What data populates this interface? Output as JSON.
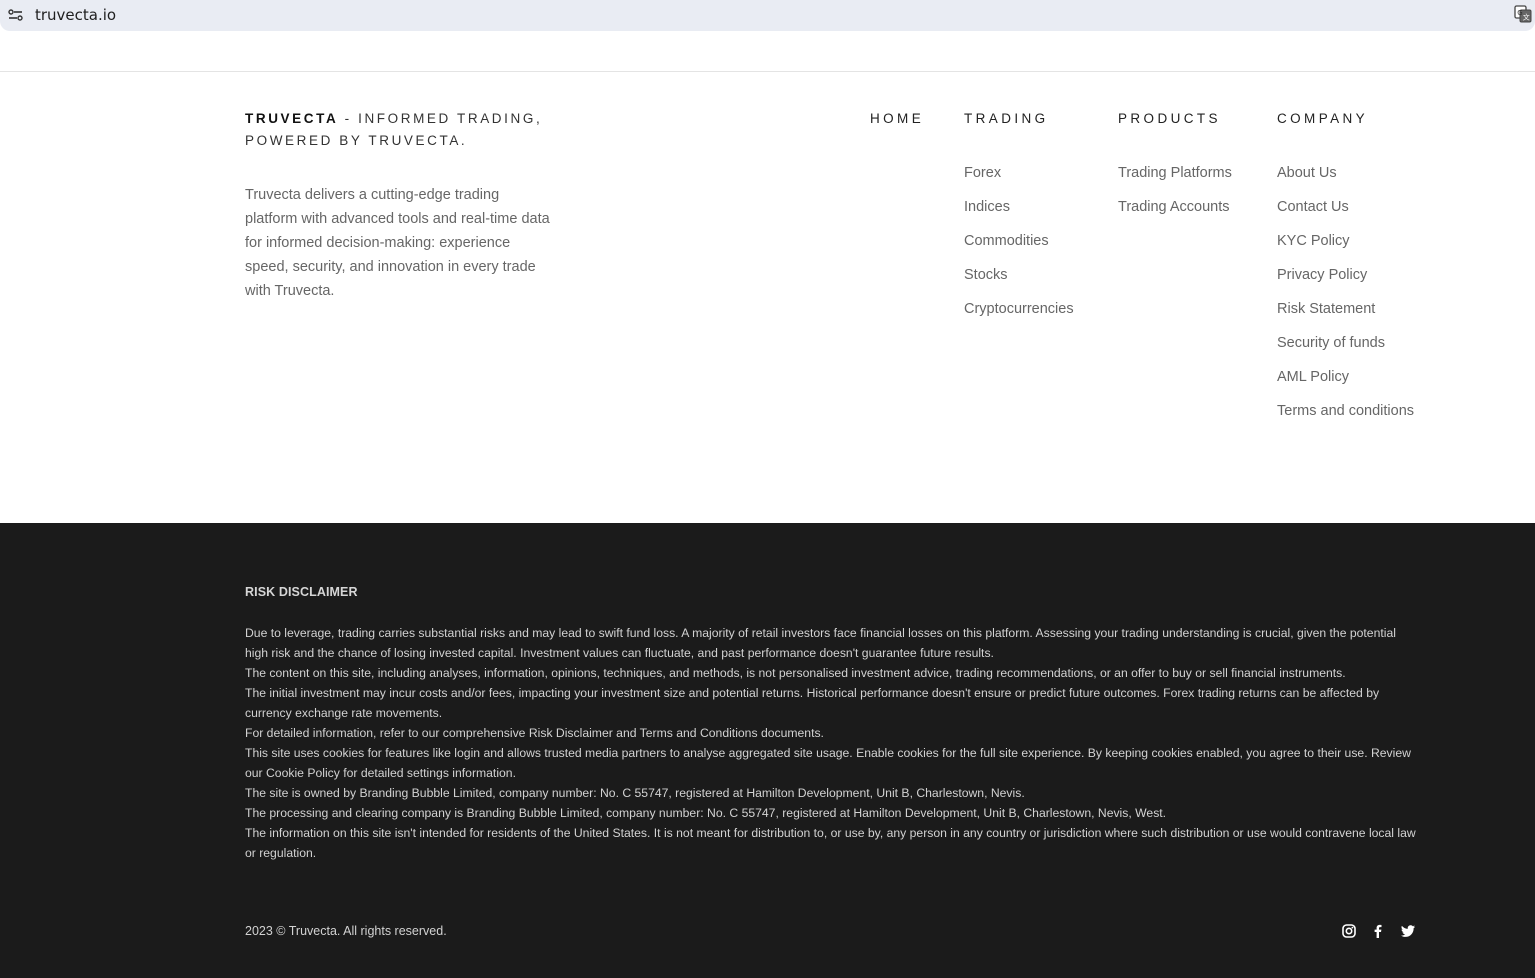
{
  "browser": {
    "url": "truvecta.io",
    "site_info_icon": "tune-icon",
    "translate_icon": "translate-icon"
  },
  "footer": {
    "brand": "TRUVECTA",
    "tagline": " - INFORMED TRADING, POWERED BY TRUVECTA.",
    "description": "Truvecta delivers a cutting-edge trading platform with advanced tools and real-time data for informed decision-making: experience speed, security, and innovation in every trade with Truvecta.",
    "nav": {
      "home": {
        "heading": "HOME"
      },
      "trading": {
        "heading": "TRADING",
        "links": [
          "Forex",
          "Indices",
          "Commodities",
          "Stocks",
          "Cryptocurrencies"
        ]
      },
      "products": {
        "heading": "PRODUCTS",
        "links": [
          "Trading Platforms",
          "Trading Accounts"
        ]
      },
      "company": {
        "heading": "COMPANY",
        "links": [
          "About Us",
          "Contact Us",
          "KYC Policy",
          "Privacy Policy",
          "Risk Statement",
          "Security of funds",
          "AML Policy",
          "Terms and conditions"
        ]
      }
    }
  },
  "disclaimer": {
    "title": "RISK DISCLAIMER",
    "paragraphs": [
      "Due to leverage, trading carries substantial risks and may lead to swift fund loss. A majority of retail investors face financial losses on this platform. Assessing your trading understanding is crucial, given the potential high risk and the chance of losing invested capital. Investment values can fluctuate, and past performance doesn't guarantee future results.",
      "The content on this site, including analyses, information, opinions, techniques, and methods, is not personalised investment advice, trading recommendations, or an offer to buy or sell financial instruments.",
      "The initial investment may incur costs and/or fees, impacting your investment size and potential returns. Historical performance doesn't ensure or predict future outcomes. Forex trading returns can be affected by currency exchange rate movements.",
      "For detailed information, refer to our comprehensive Risk Disclaimer and Terms and Conditions documents.",
      "This site uses cookies for features like login and allows trusted media partners to analyse aggregated site usage. Enable cookies for the full site experience. By keeping cookies enabled, you agree to their use. Review our Cookie Policy for detailed settings information.",
      "The site is owned by Branding Bubble Limited, company number: No. C 55747, registered at Hamilton Development, Unit B, Charlestown, Nevis.",
      "The processing and clearing company is Branding Bubble Limited, company number: No. C 55747, registered at Hamilton Development, Unit B, Charlestown, Nevis, West.",
      "The information on this site isn't intended for residents of the United States. It is not meant for distribution to, or use by, any person in any country or jurisdiction where such distribution or use would contravene local law or regulation."
    ],
    "copyright": "2023 © Truvecta. All rights reserved.",
    "social": [
      "instagram-icon",
      "facebook-icon",
      "twitter-icon"
    ]
  },
  "colors": {
    "dark_bg": "#1b1b1b",
    "address_bar": "#e9ecf3"
  }
}
